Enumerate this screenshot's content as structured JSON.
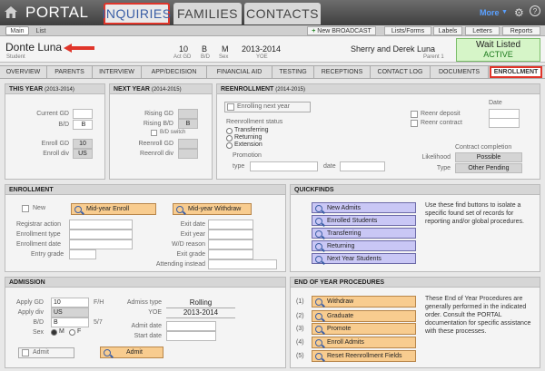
{
  "app": {
    "title": "PORTAL",
    "more_label": "More"
  },
  "top_tabs": [
    "INQUIRIES",
    "FAMILIES",
    "CONTACTS"
  ],
  "sub_tabs": [
    "Main",
    "List"
  ],
  "toolbar": {
    "broadcast": "New BROADCAST",
    "lists_forms": "Lists/Forms",
    "labels": "Labels",
    "letters": "Letters",
    "reports": "Reports"
  },
  "student": {
    "name": "Donte Luna",
    "label": "Student"
  },
  "header_fields": [
    {
      "value": "10",
      "label": "Act GD"
    },
    {
      "value": "B",
      "label": "B/D"
    },
    {
      "value": "M",
      "label": "Sex"
    },
    {
      "value": "2013-2014",
      "label": "YOE"
    }
  ],
  "parents": {
    "name": "Sherry and Derek Luna",
    "label": "Parent 1"
  },
  "status": {
    "text": "Wait Listed",
    "state": "ACTIVE",
    "color": "#d6f5c8"
  },
  "nav_tabs": [
    "OVERVIEW",
    "PARENTS",
    "INTERVIEW",
    "APP/DECISION",
    "FINANCIAL AID",
    "TESTING",
    "RECEPTIONS",
    "CONTACT LOG",
    "DOCUMENTS",
    "ENROLLMENT"
  ],
  "this_year": {
    "title": "THIS YEAR",
    "range": "(2013-2014)",
    "current_gd_label": "Current GD",
    "current_gd": "",
    "bd_label": "B/D",
    "bd": "B",
    "enroll_gd_label": "Enroll GD",
    "enroll_gd": "10",
    "enroll_div_label": "Enroll div",
    "enroll_div": "US"
  },
  "next_year": {
    "title": "NEXT YEAR",
    "range": "(2014-2015)",
    "rising_gd_label": "Rising GD",
    "rising_bd_label": "Rising B/D",
    "rising_bd": "B",
    "bd_switch_label": "B/D switch",
    "reenroll_gd_label": "Reenroll GD",
    "reenroll_div_label": "Reenroll div"
  },
  "reenrollment": {
    "title": "REENROLLMENT",
    "range": "(2014-2015)",
    "enrolling_next_year": "Enrolling next year",
    "status_label": "Reenrollment status",
    "options": [
      "Transferring",
      "Returning",
      "Extension"
    ],
    "promotion_label": "Promotion",
    "type_label": "type",
    "date_label": "date",
    "date_header": "Date",
    "deposit_label": "Reenr deposit",
    "contract_label": "Reenr contract",
    "contract_completion_label": "Contract completion",
    "likelihood_label": "Likelihood",
    "likelihood": "Possible",
    "type2_label": "Type",
    "type2": "Other Pending"
  },
  "enrollment": {
    "title": "ENROLLMENT",
    "new_label": "New",
    "mid_enroll": "Mid-year Enroll",
    "mid_withdraw": "Mid-year Withdraw",
    "left_labels": [
      "Registrar action",
      "Enrollment type",
      "Enrollment date",
      "Entry grade"
    ],
    "right_labels": [
      "Exit date",
      "Exit year",
      "W/D reason",
      "Exit grade",
      "Attending instead"
    ]
  },
  "quickfinds": {
    "title": "QUICKFINDS",
    "buttons": [
      "New Admits",
      "Enrolled Students",
      "Transferring",
      "Returning",
      "Next Year Students"
    ],
    "description": "Use these find buttons to isolate a specific found set of records for reporting and/or global procedures."
  },
  "admission": {
    "title": "ADMISSION",
    "apply_gd_label": "Apply GD",
    "apply_gd": "10",
    "fh_label": "F/H",
    "apply_div_label": "Apply div",
    "apply_div": "US",
    "bd_label": "B/D",
    "bd": "B",
    "ratio_label": "5/7",
    "sex_label": "Sex",
    "sex_m": "M",
    "sex_f": "F",
    "admiss_type_label": "Admiss type",
    "admiss_type": "Rolling",
    "yoe_label": "YOE",
    "yoe": "2013-2014",
    "admit_date_label": "Admit date",
    "start_date_label": "Start date",
    "admit_check_label": "Admit",
    "admit_button": "Admit"
  },
  "eoy": {
    "title": "END OF YEAR PROCEDURES",
    "steps": [
      {
        "num": "(1)",
        "label": "Withdraw"
      },
      {
        "num": "(2)",
        "label": "Graduate"
      },
      {
        "num": "(3)",
        "label": "Promote"
      },
      {
        "num": "(4)",
        "label": "Enroll Admits"
      },
      {
        "num": "(5)",
        "label": "Reset Reenrollment Fields"
      }
    ],
    "description": "These End of Year Procedures are generally performed in the indicated order. Consult the PORTAL documentation for specific assistance with these processes."
  }
}
